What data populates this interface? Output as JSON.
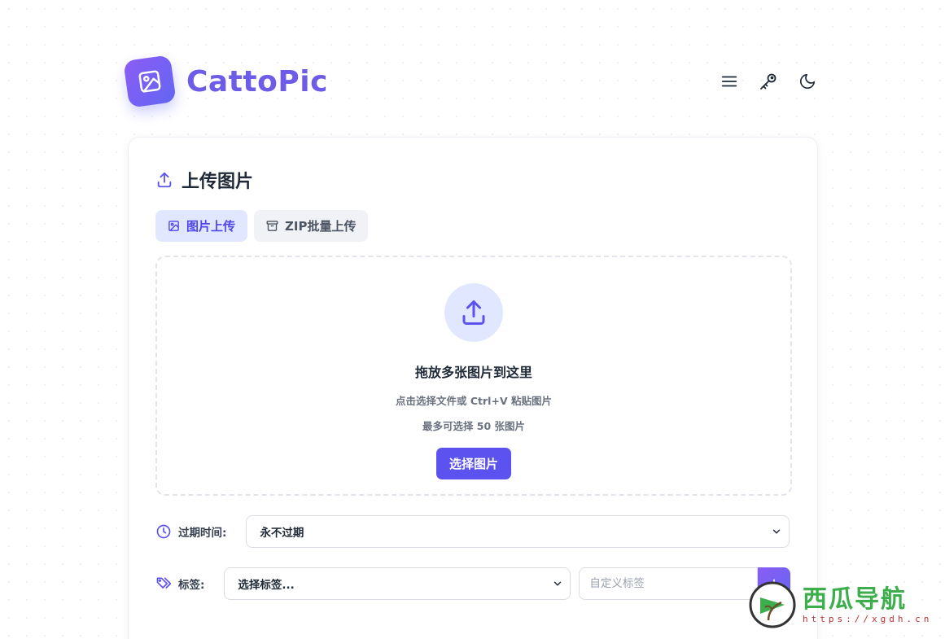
{
  "header": {
    "brand_name": "CattoPic",
    "icons": [
      "image-icon",
      "menu-icon",
      "key-icon",
      "moon-icon"
    ]
  },
  "card": {
    "title": "上传图片",
    "tabs": [
      {
        "label": "图片上传",
        "icon": "image-icon",
        "active": true
      },
      {
        "label": "ZIP批量上传",
        "icon": "archive-icon",
        "active": false
      }
    ],
    "dropzone": {
      "title": "拖放多张图片到这里",
      "subtitle": "点击选择文件或 Ctrl+V 粘贴图片",
      "limit": "最多可选择 50 张图片",
      "button_label": "选择图片"
    },
    "expiry": {
      "label": "过期时间:",
      "selected": "永不过期"
    },
    "tags": {
      "label": "标签:",
      "select_placeholder": "选择标签...",
      "custom_placeholder": "自定义标签"
    }
  },
  "watermark": {
    "title": "西瓜导航",
    "url": "https://xgdh.cn"
  },
  "colors": {
    "accent": "#5b52f0",
    "accent_light": "#e0e7ff",
    "brand_text": "#6d5ce8",
    "watermark_green": "#3cae4c",
    "watermark_red": "#c53030"
  }
}
